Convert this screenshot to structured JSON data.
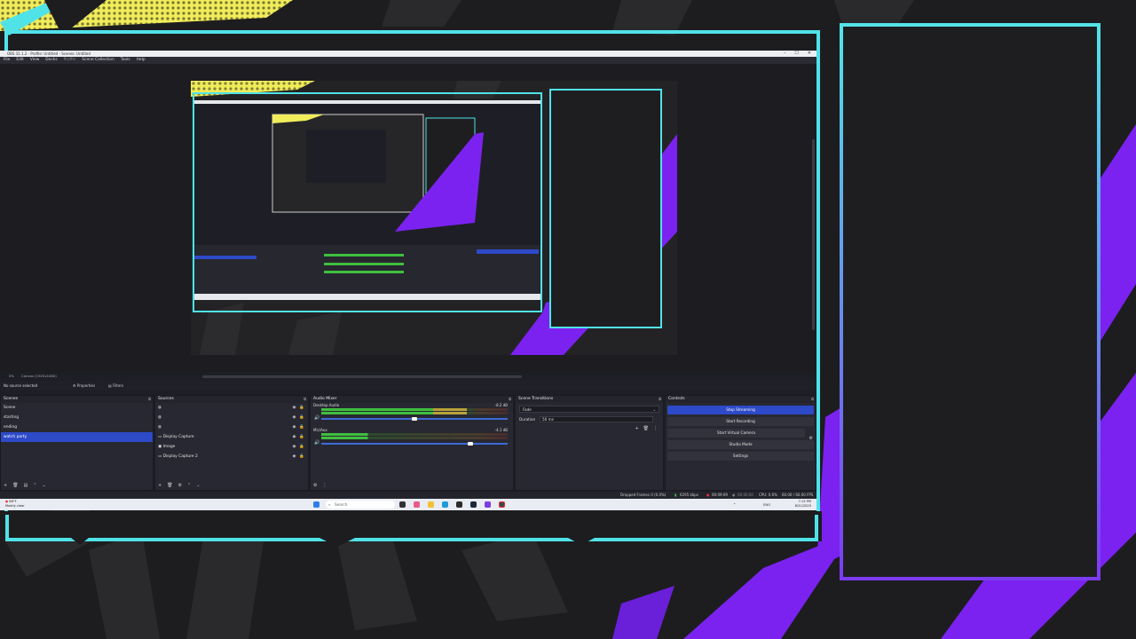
{
  "window": {
    "title": "OBS 31.1.2 - Profile: Untitled - Scenes: Untitled",
    "controls": [
      "–",
      "☐",
      "✕"
    ]
  },
  "menu": [
    "File",
    "Edit",
    "View",
    "Docks",
    "Profile",
    "Scene Collection",
    "Tools",
    "Help"
  ],
  "preview_status": {
    "fps": "0%",
    "canvas": "Canvas (1920x1080)"
  },
  "context_bar": {
    "no_source": "No source selected",
    "properties": "Properties",
    "filters": "Filters"
  },
  "scenes": {
    "title": "Scenes",
    "items": [
      "Scene",
      "starting",
      "ending",
      "watch party"
    ],
    "selected_index": 3
  },
  "sources": {
    "title": "Sources",
    "items": [
      {
        "label": "",
        "icon": "globe-icon"
      },
      {
        "label": "",
        "icon": "globe-icon"
      },
      {
        "label": "",
        "icon": "globe-icon"
      },
      {
        "label": "Display Capture",
        "icon": "monitor-icon"
      },
      {
        "label": "Image",
        "icon": "image-icon"
      },
      {
        "label": "Display Capture 2",
        "icon": "monitor-icon"
      }
    ]
  },
  "mixer": {
    "title": "Audio Mixer",
    "channels": [
      {
        "name": "Desktop Audio",
        "db": "-8.2 dB",
        "level": 0.78,
        "volume": 0.5
      },
      {
        "name": "Mic/Aux",
        "db": "-4.1 dB",
        "level": 0.25,
        "volume": 0.8
      }
    ]
  },
  "transitions": {
    "title": "Scene Transitions",
    "selected": "Fade",
    "duration_label": "Duration",
    "duration_value": "50 ms"
  },
  "controls": {
    "title": "Controls",
    "buttons": [
      "Stop Streaming",
      "Start Recording",
      "Start Virtual Camera",
      "Studio Mode",
      "Settings"
    ]
  },
  "statusbar": {
    "dropped": "Dropped Frames 0 (0.0%)",
    "bitrate": "6295 kbps",
    "stream_time": "00:09:09",
    "rec_time": "00:00:00",
    "cpu": "CPU: 0.6%",
    "fps": "60.00 / 60.00 FPS"
  },
  "taskbar": {
    "weather_temp": "68°F",
    "weather_desc": "Mostly clear",
    "search_placeholder": "Search",
    "lang": "ENG",
    "time": "7:13 PM",
    "date": "8/31/2025"
  },
  "colors": {
    "accent": "#2d4ac8",
    "frame_cyan": "#4fe3e8",
    "overlay_purple": "#7b22f0",
    "overlay_yellow": "#f1ec5a"
  }
}
